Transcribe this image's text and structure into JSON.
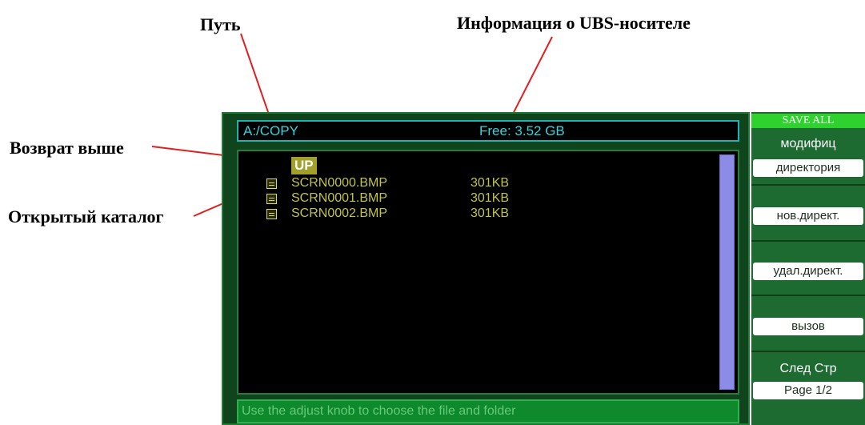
{
  "annotations": {
    "path": "Путь",
    "usb_info": "Информация о UBS-носителе",
    "back_up": "Возврат выше",
    "open_dir": "Открытый каталог"
  },
  "pathbar": {
    "path": "A:/COPY",
    "free": "Free: 3.52 GB"
  },
  "files": {
    "up_label": "UP",
    "items": [
      {
        "name": "SCRN0000.BMP",
        "size": "301KB",
        "icon": "file-icon"
      },
      {
        "name": "SCRN0001.BMP",
        "size": "301KB",
        "icon": "file-icon"
      },
      {
        "name": "SCRN0002.BMP",
        "size": "301KB",
        "icon": "file-icon"
      }
    ]
  },
  "status": "Use the adjust knob to choose the file and folder",
  "softkeys": {
    "header": "SAVE ALL",
    "modify_title": "модифиц",
    "modify_value": "директория",
    "new_dir": "нов.директ.",
    "del_dir": "удал.директ.",
    "recall": "вызов",
    "next_title": "След Стр",
    "next_value": "Page 1/2"
  },
  "colors": {
    "screen_bg": "#10441c",
    "path_text": "#36d3da",
    "file_text": "#c2c24a",
    "softkey_header": "#2ed12e",
    "scrollbar": "#8c8ce6"
  }
}
